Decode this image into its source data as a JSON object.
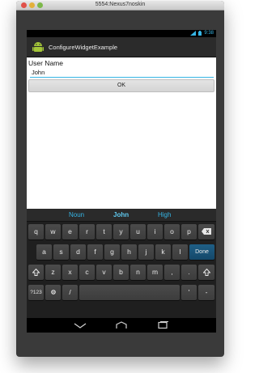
{
  "window": {
    "title": "5554:Nexus7noskin"
  },
  "status": {
    "time": "9:38"
  },
  "app": {
    "title": "ConfigureWidgetExample"
  },
  "form": {
    "label": "User Name",
    "value": "John",
    "ok_label": "OK"
  },
  "keyboard": {
    "suggestions": [
      "Noun",
      "John",
      "High"
    ],
    "row1": [
      "q",
      "w",
      "e",
      "r",
      "t",
      "y",
      "u",
      "i",
      "o",
      "p"
    ],
    "row2": [
      "a",
      "s",
      "d",
      "f",
      "g",
      "h",
      "j",
      "k",
      "l"
    ],
    "row2_done": "Done",
    "row3": [
      "z",
      "x",
      "c",
      "v",
      "b",
      "n",
      "m",
      ",",
      "."
    ],
    "row4": {
      "sym": "?123",
      "slash": "/",
      "apostrophe": "'",
      "dash": "-",
      "smiley": ":-)"
    }
  },
  "icons": {
    "shift": "shift-icon",
    "backspace": "backspace-icon",
    "settings": "keyboard-settings-icon",
    "back": "back-icon",
    "home": "home-icon",
    "recent": "recent-apps-icon",
    "android": "android-icon",
    "wifi": "wifi-icon",
    "battery": "battery-icon"
  },
  "colors": {
    "accent": "#35b5e5",
    "done": "#1f5f86",
    "keyboard_bg": "#1f1f1f",
    "actionbar": "#2b2b2b"
  }
}
